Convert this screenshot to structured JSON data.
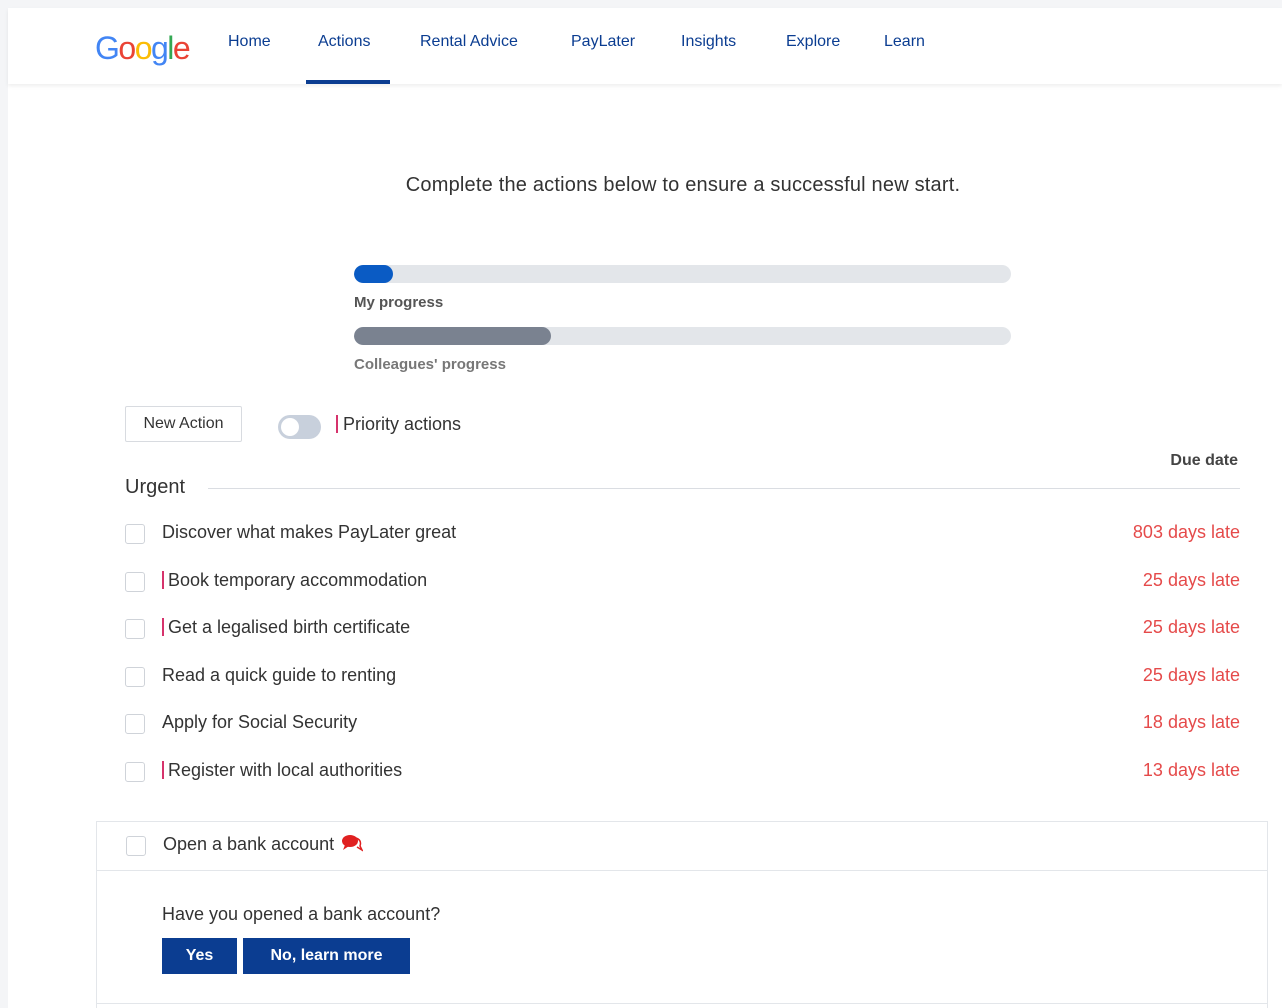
{
  "logo": {
    "letters": [
      "G",
      "o",
      "o",
      "g",
      "l",
      "e"
    ],
    "colors": [
      "#4285F4",
      "#EA4335",
      "#FBBC05",
      "#4285F4",
      "#34A853",
      "#EA4335"
    ]
  },
  "nav": {
    "items": [
      {
        "label": "Home"
      },
      {
        "label": "Actions"
      },
      {
        "label": "Rental Advice"
      },
      {
        "label": "PayLater"
      },
      {
        "label": "Insights"
      },
      {
        "label": "Explore"
      },
      {
        "label": "Learn"
      }
    ],
    "active": "Actions"
  },
  "intro": "Complete the actions below to ensure a successful new start.",
  "progress": {
    "my": {
      "label": "My progress",
      "percent": 6,
      "color": "#0a5bc4"
    },
    "colleagues": {
      "label": "Colleagues' progress",
      "percent": 30,
      "color": "#7a8290"
    }
  },
  "controls": {
    "new_action": "New Action",
    "priority_toggle_on": false,
    "priority_label": "Priority actions"
  },
  "table": {
    "due_header": "Due date",
    "section": "Urgent",
    "rows": [
      {
        "task": "Discover what makes PayLater great",
        "due": "803 days late",
        "priority": false
      },
      {
        "task": "Book temporary accommodation",
        "due": "25 days late",
        "priority": true
      },
      {
        "task": "Get a legalised birth certificate",
        "due": "25 days late",
        "priority": true
      },
      {
        "task": "Read a quick guide to renting",
        "due": "25 days late",
        "priority": false
      },
      {
        "task": "Apply for Social Security",
        "due": "18 days late",
        "priority": false
      },
      {
        "task": "Register with local authorities",
        "due": "13 days late",
        "priority": true
      }
    ]
  },
  "expanded": {
    "task": "Open a bank account",
    "icon": "chat-bubble-icon",
    "question": "Have you opened a bank account?",
    "yes": "Yes",
    "no": "No, learn more"
  },
  "colors": {
    "brand": "#0b3d91",
    "late": "#e54a4a",
    "priority_marker": "#d6336c"
  }
}
